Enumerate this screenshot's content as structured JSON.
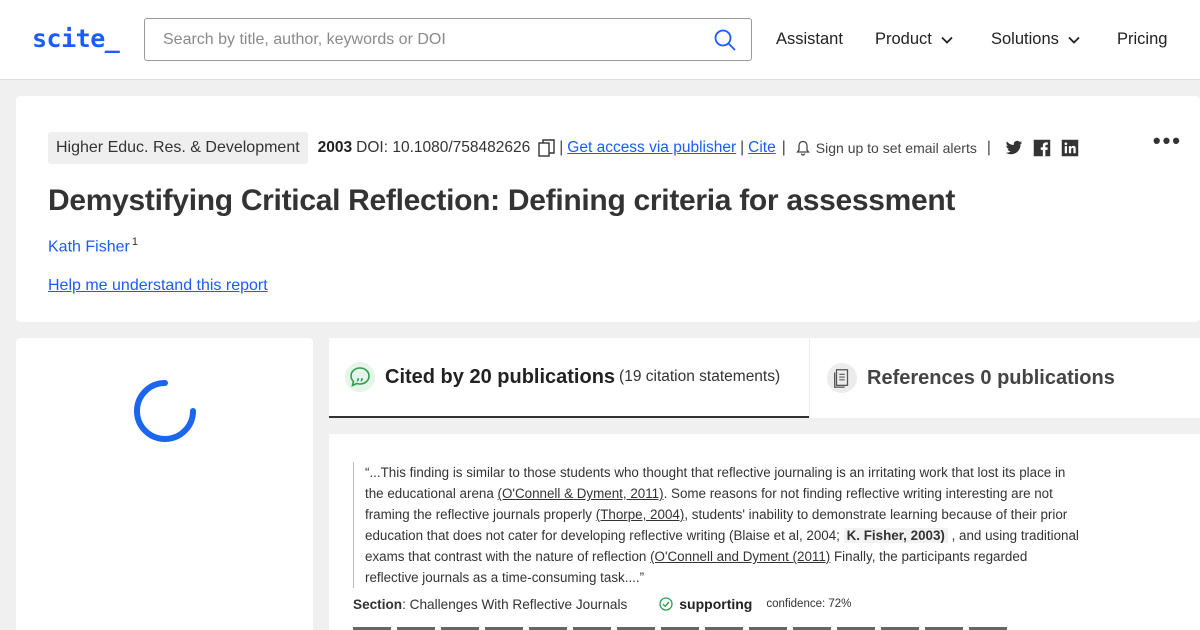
{
  "header": {
    "logo": "scite_",
    "search_placeholder": "Search by title, author, keywords or DOI",
    "nav": [
      {
        "label": "Assistant"
      },
      {
        "label": "Product"
      },
      {
        "label": "Solutions"
      },
      {
        "label": "Pricing"
      }
    ],
    "accent_color": "#1a5cff"
  },
  "article": {
    "journal": "Higher Educ. Res. & Development",
    "year": "2003",
    "doi": "DOI: 10.1080/758482626",
    "access_link": "Get access via publisher",
    "cite_link": "Cite",
    "alerts": "Sign up to set email alerts",
    "title": "Demystifying Critical Reflection: Defining criteria for assessment",
    "author": "Kath Fisher",
    "author_sup": "1",
    "help_link": "Help me understand this report"
  },
  "tabs": {
    "cited_label": "Cited by 20 publications",
    "cited_sub": "(19 citation statements)",
    "refs_label": "References 0 publications"
  },
  "citation": {
    "q1": "“...This finding is similar to those students who thought that reflective journaling is an irritating work that lost its place in the educational arena ",
    "r1": "(O'Connell & Dyment, 2011)",
    "q2": ". Some reasons for not finding reflective writing interesting are not framing the reflective journals properly ",
    "r2": "(Thorpe, 2004)",
    "q3": ", students' inability to demonstrate learning because of their prior education that does not cater for developing reflective writing (Blaise et al, 2004; ",
    "hl": "K. Fisher, 2003)",
    "q4": " , and using traditional exams that contrast with the nature of reflection ",
    "r3": "(O'Connell and Dyment (2011)",
    "q5": " Finally, the participants regarded reflective journals as a time-consuming task....”",
    "section_label": "Section",
    "section_value": ": Challenges With Reflective Journals",
    "support_label": "supporting",
    "confidence": "confidence: 72%",
    "support_color": "#2e9e4f"
  }
}
